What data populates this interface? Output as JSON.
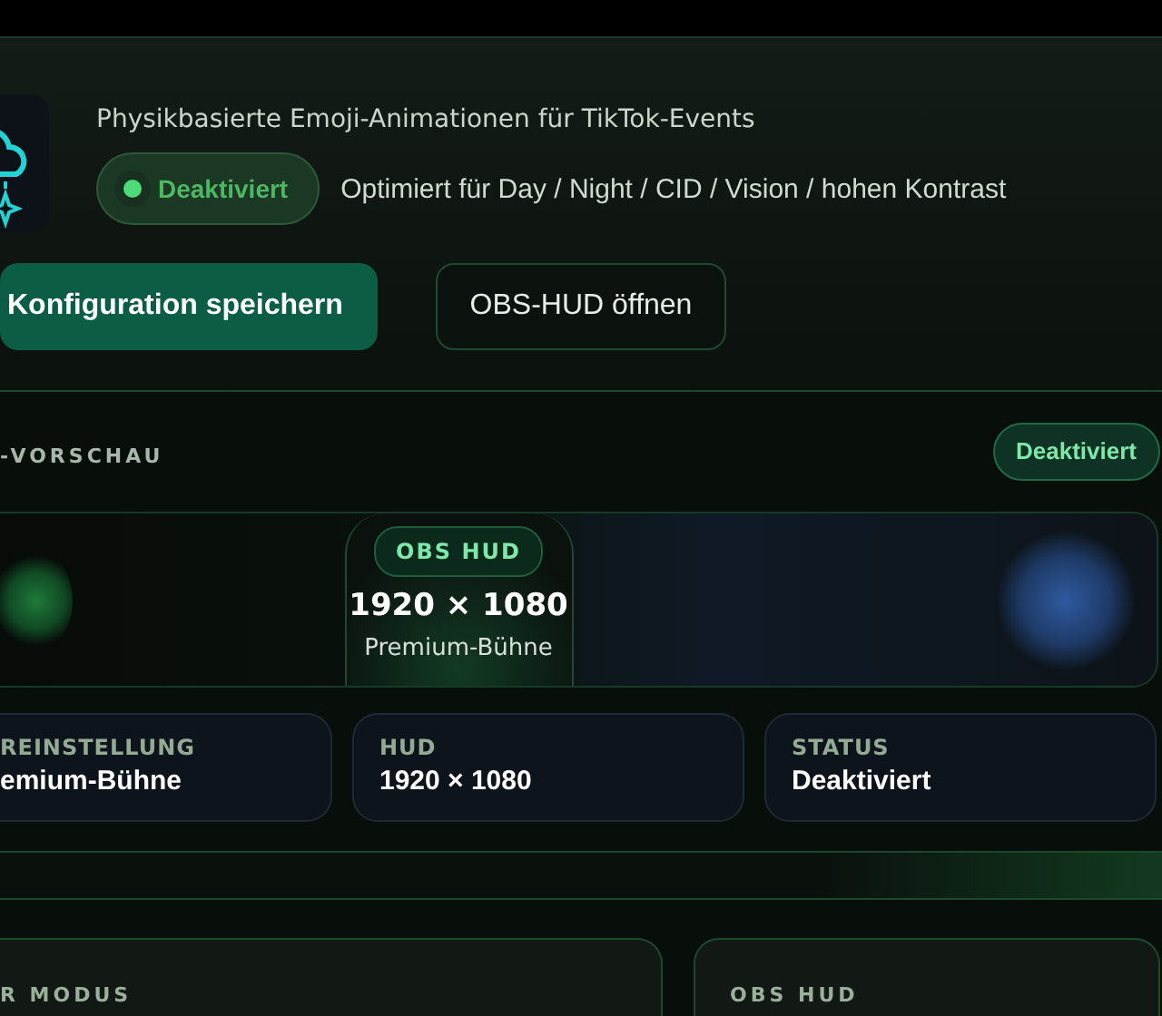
{
  "header": {
    "subtitle": "Physikbasierte Emoji-Animationen für TikTok-Events",
    "status_pill": "Deaktiviert",
    "modes_note": "Optimiert für Day / Night / CID / Vision / hohen Kontrast",
    "buttons": [
      {
        "label": "Konfiguration speichern",
        "kind": "primary"
      },
      {
        "label": "OBS-HUD öffnen",
        "kind": "secondary"
      }
    ]
  },
  "preview": {
    "title": "-VORSCHAU",
    "badge": "Deaktiviert",
    "hud": {
      "tag": "OBS HUD",
      "resolution": "1920 × 1080",
      "preset": "Premium-Bühne"
    }
  },
  "stats": [
    {
      "label": "REINSTELLUNG",
      "value": "emium-Bühne"
    },
    {
      "label": "HUD",
      "value": "1920 × 1080"
    },
    {
      "label": "STATUS",
      "value": "Deaktiviert"
    }
  ],
  "panels": [
    {
      "title": "R MODUS"
    },
    {
      "title": "OBS HUD"
    }
  ]
}
